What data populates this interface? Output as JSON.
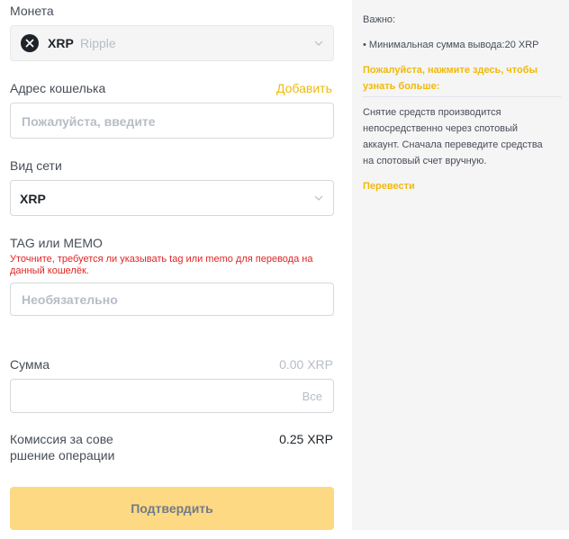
{
  "coin": {
    "label": "Монета",
    "symbol": "XRP",
    "name": "Ripple"
  },
  "wallet": {
    "label": "Адрес кошелька",
    "add_link": "Добавить",
    "placeholder": "Пожалуйста, введите"
  },
  "network": {
    "label": "Вид сети",
    "value": "XRP"
  },
  "tag": {
    "label": "TAG или MEMO",
    "warning": "Уточните, требуется ли указывать tag или memo для перевода на данный кошелёк.",
    "placeholder": "Необязательно"
  },
  "amount": {
    "label": "Сумма",
    "balance": "0.00 XRP",
    "all_button": "Все"
  },
  "fee": {
    "label": "Комиссия за сове\nршение операции",
    "value": "0.25 XRP"
  },
  "confirm_button": "Подтвердить",
  "info_panel": {
    "title": "Важно:",
    "min_withdraw": "• Минимальная сумма вывода:20 XRP",
    "learn_more": "Пожалуйста, нажмите здесь, чтобы узнать больше:",
    "spot_note": "Снятие средств производится непосредственно через спотовый аккаунт. Сначала переведите средства на спотовый счет вручную.",
    "transfer_link": "Перевести"
  },
  "colors": {
    "accent": "#f0b90b",
    "warning": "#e02424",
    "button_bg": "#fcd982"
  }
}
